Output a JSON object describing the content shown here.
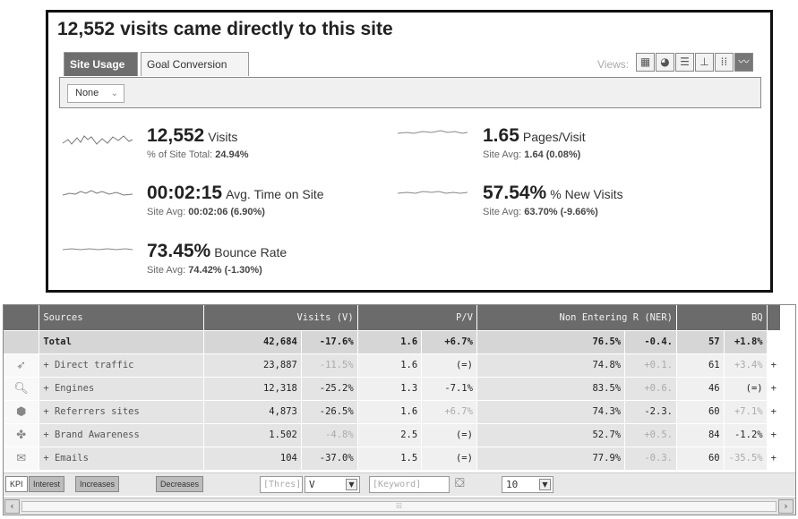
{
  "summary": {
    "headline": "12,552 visits came directly to this site",
    "tabs": {
      "site_usage": "Site Usage",
      "goal_conversion": "Goal Conversion"
    },
    "views_label": "Views:",
    "views": [
      {
        "icon": "table-view-icon",
        "glyph": "▦"
      },
      {
        "icon": "pie-view-icon",
        "glyph": "◕"
      },
      {
        "icon": "bar-view-icon",
        "glyph": "☰"
      },
      {
        "icon": "comparison-view-icon",
        "glyph": "⊥"
      },
      {
        "icon": "pivot-view-icon",
        "glyph": "⁞⁞"
      },
      {
        "icon": "sparkline-view-icon",
        "glyph": "〰"
      }
    ],
    "filter_select": "None",
    "metrics": {
      "visits": {
        "value": "12,552",
        "label": "Visits",
        "sub_text": "% of Site Total:",
        "sub_value": "24.94%"
      },
      "pages_visit": {
        "value": "1.65",
        "label": "Pages/Visit",
        "sub_text": "Site Avg:",
        "sub_value": "1.64 (0.08%)"
      },
      "time_on_site": {
        "value": "00:02:15",
        "label": "Avg. Time on Site",
        "sub_text": "Site Avg:",
        "sub_value": "00:02:06 (6.90%)"
      },
      "new_visits": {
        "value": "57.54%",
        "label": "% New Visits",
        "sub_text": "Site Avg:",
        "sub_value": "63.70% (-9.66%)"
      },
      "bounce_rate": {
        "value": "73.45%",
        "label": "Bounce Rate",
        "sub_text": "Site Avg:",
        "sub_value": "74.42% (-1.30%)"
      }
    }
  },
  "table": {
    "headers": {
      "sources": "Sources",
      "visits": "Visits (V)",
      "pv": "P/V",
      "ner": "Non Entering R (NER)",
      "bq": "BQ"
    },
    "total": {
      "label": "Total",
      "visits": "42,684",
      "visits_chg": "-17.6%",
      "pv": "1.6",
      "pv_chg": "+6.7%",
      "ner": "76.5%",
      "ner_chg": "-0.4.",
      "bq": "57",
      "bq_chg": "+1.8%"
    },
    "rows": [
      {
        "icon": "direct-traffic-icon",
        "glyph": "➶",
        "label": "+ Direct traffic",
        "visits": "23,887",
        "visits_chg": "-11.5%",
        "pv": "1.6",
        "pv_chg": "(=)",
        "ner": "74.8%",
        "ner_chg": "+0.1.",
        "bq": "61",
        "bq_chg": "+3.4%"
      },
      {
        "icon": "search-engine-icon",
        "glyph": "🔍︎",
        "label": "+ Engines",
        "visits": "12,318",
        "visits_chg": "-25.2%",
        "pv": "1.3",
        "pv_chg": "-7.1%",
        "ner": "83.5%",
        "ner_chg": "+0.6.",
        "bq": "46",
        "bq_chg": "(=)"
      },
      {
        "icon": "referrer-icon",
        "glyph": "⬢",
        "label": "+ Referrers sites",
        "visits": "4,873",
        "visits_chg": "-26.5%",
        "pv": "1.6",
        "pv_chg": "+6.7%",
        "ner": "74.3%",
        "ner_chg": "-2.3.",
        "bq": "60",
        "bq_chg": "+7.1%"
      },
      {
        "icon": "puzzle-icon",
        "glyph": "✤",
        "label": "+ Brand Awareness",
        "visits": "1.502",
        "visits_chg": "-4.8%",
        "pv": "2.5",
        "pv_chg": "(=)",
        "ner": "52.7%",
        "ner_chg": "+0.5.",
        "bq": "84",
        "bq_chg": "-1.2%"
      },
      {
        "icon": "email-icon",
        "glyph": "✉",
        "label": "+ Emails",
        "visits": "104",
        "visits_chg": "-37.0%",
        "pv": "1.5",
        "pv_chg": "(=)",
        "ner": "77.9%",
        "ner_chg": "-0.3.",
        "bq": "60",
        "bq_chg": "-35.5%"
      }
    ],
    "footer": {
      "tabs": [
        "KPI",
        "Interest",
        "Increases",
        "Decreases"
      ],
      "threshold_placeholder": "[Thres]",
      "metric_select": "V",
      "keyword_placeholder": "[Keyword]",
      "rows_select": "10"
    }
  }
}
